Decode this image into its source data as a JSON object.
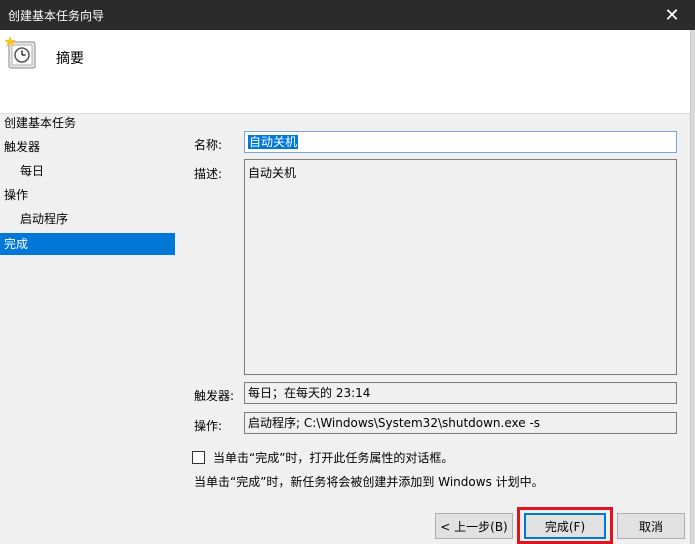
{
  "window": {
    "title": "创建基本任务向导",
    "close_glyph": "✕"
  },
  "header": {
    "title": "摘要",
    "icon": "clock-task-wizard-icon"
  },
  "sidebar": {
    "items": [
      {
        "label": "创建基本任务",
        "level": 1,
        "active": false
      },
      {
        "label": "触发器",
        "level": 1,
        "active": false
      },
      {
        "label": "每日",
        "level": 2,
        "active": false
      },
      {
        "label": "操作",
        "level": 1,
        "active": false
      },
      {
        "label": "启动程序",
        "level": 2,
        "active": false
      },
      {
        "label": "完成",
        "level": 1,
        "active": true
      }
    ]
  },
  "form": {
    "name_label": "名称:",
    "name_value": "自动关机",
    "description_label": "描述:",
    "description_value": "自动关机",
    "trigger_label": "触发器:",
    "trigger_value": "每日；在每天的 23:14",
    "action_label": "操作:",
    "action_value": "启动程序; C:\\Windows\\System32\\shutdown.exe -s",
    "checkbox_label": "当单击“完成”时，打开此任务属性的对话框。",
    "checkbox_checked": false,
    "note": "当单击“完成”时，新任务将会被创建并添加到 Windows 计划中。"
  },
  "buttons": {
    "back": "< 上一步(B)",
    "finish": "完成(F)",
    "cancel": "取消"
  },
  "colors": {
    "titlebar": "#2b2b2b",
    "accent": "#0078d7",
    "highlight_box": "#e0141e"
  }
}
